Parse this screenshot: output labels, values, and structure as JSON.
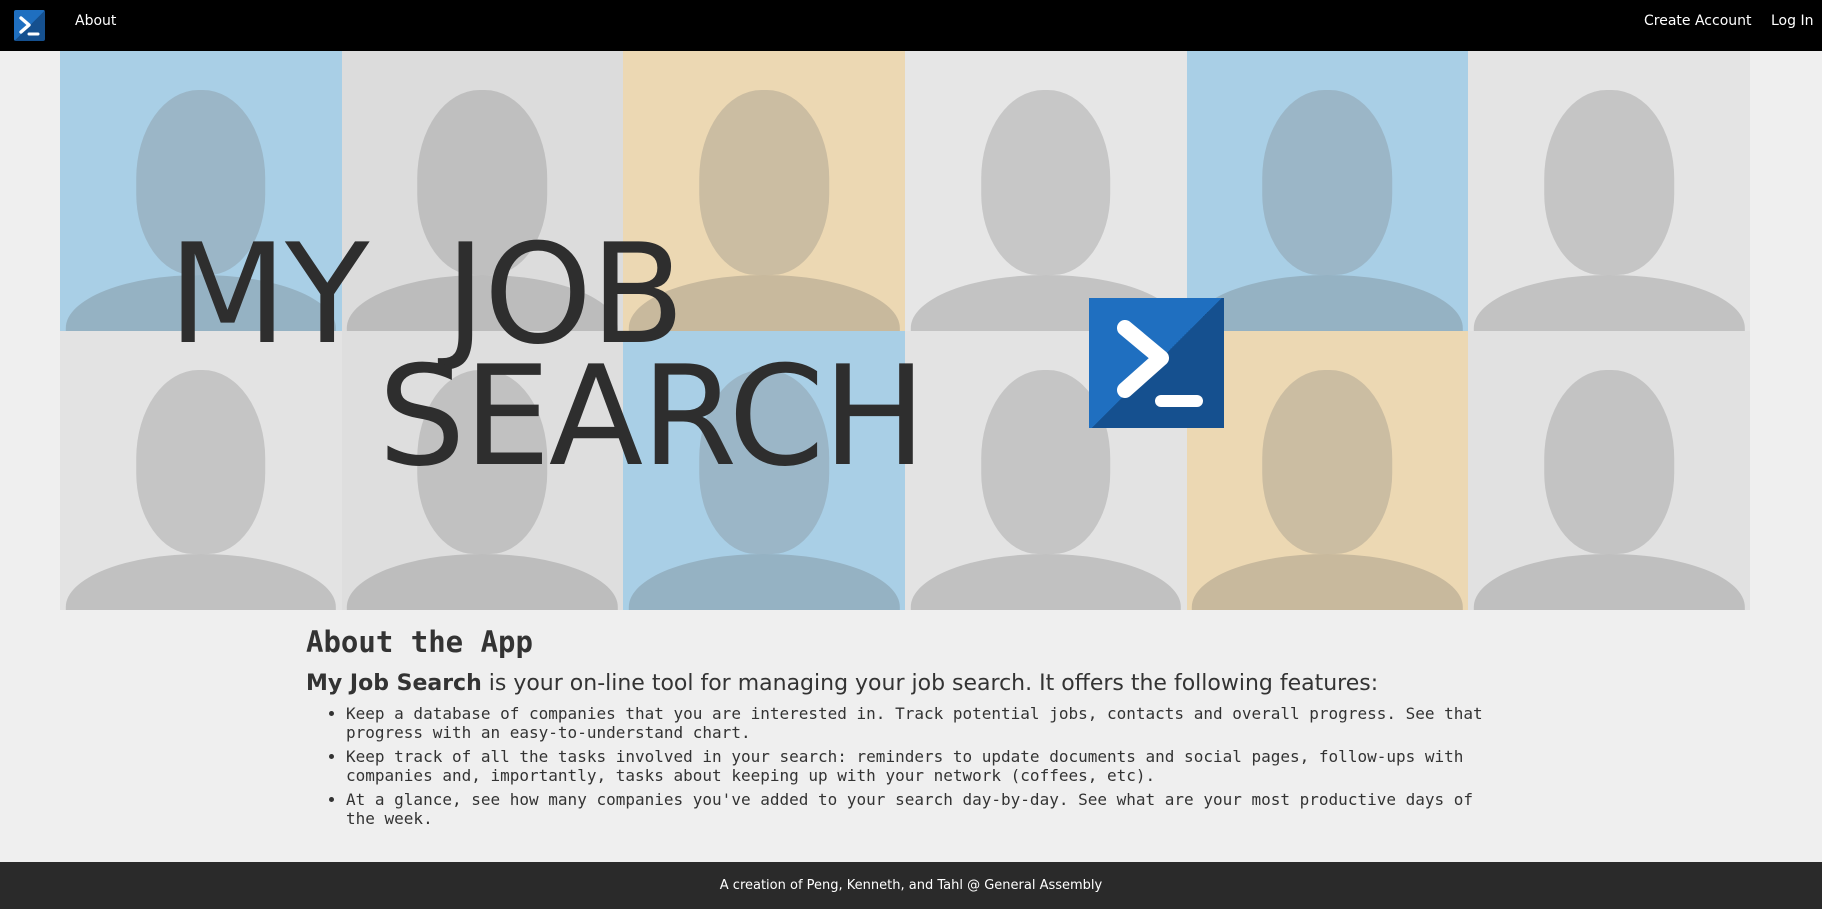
{
  "nav": {
    "about_label": "About",
    "create_account_label": "Create Account",
    "login_label": "Log In"
  },
  "hero": {
    "title_line1_word1": "MY",
    "title_line1_word2": "JOB",
    "title_line2": "SEARCH",
    "tiles": [
      {
        "color": "#a9cfe6"
      },
      {
        "color": "#dcdcdc"
      },
      {
        "color": "#ecd8b3"
      },
      {
        "color": "#e6e6e6"
      },
      {
        "color": "#a9cfe6"
      },
      {
        "color": "#e4e4e4"
      },
      {
        "color": "#e3e3e3"
      },
      {
        "color": "#dedede"
      },
      {
        "color": "#a9cfe6"
      },
      {
        "color": "#e3e3e3"
      },
      {
        "color": "#ecd8b3"
      },
      {
        "color": "#e1e1e1"
      }
    ]
  },
  "about": {
    "title": "About the App",
    "intro_name": "My Job Search",
    "intro_rest": " is your on-line tool for managing your job search. It offers the following features:",
    "features": [
      "Keep a database of companies that you are interested in. Track potential jobs, contacts and overall progress. See that progress with an easy-to-understand chart.",
      "Keep track of all the tasks involved in your search: reminders to update documents and social pages, follow-ups with companies and, importantly, tasks about keeping up with your network (coffees, etc).",
      "At a glance, see how many companies you've added to your search day-by-day. See what are your most productive days of the week."
    ]
  },
  "footer": {
    "text": "A creation of Peng, Kenneth, and Tahl @ General Assembly"
  },
  "colors": {
    "nav_bg": "#000000",
    "footer_bg": "#2a2a2a",
    "brand_blue": "#1f6fc0",
    "page_bg": "#efefef"
  },
  "icons": {
    "brand": "terminal-prompt-icon"
  }
}
